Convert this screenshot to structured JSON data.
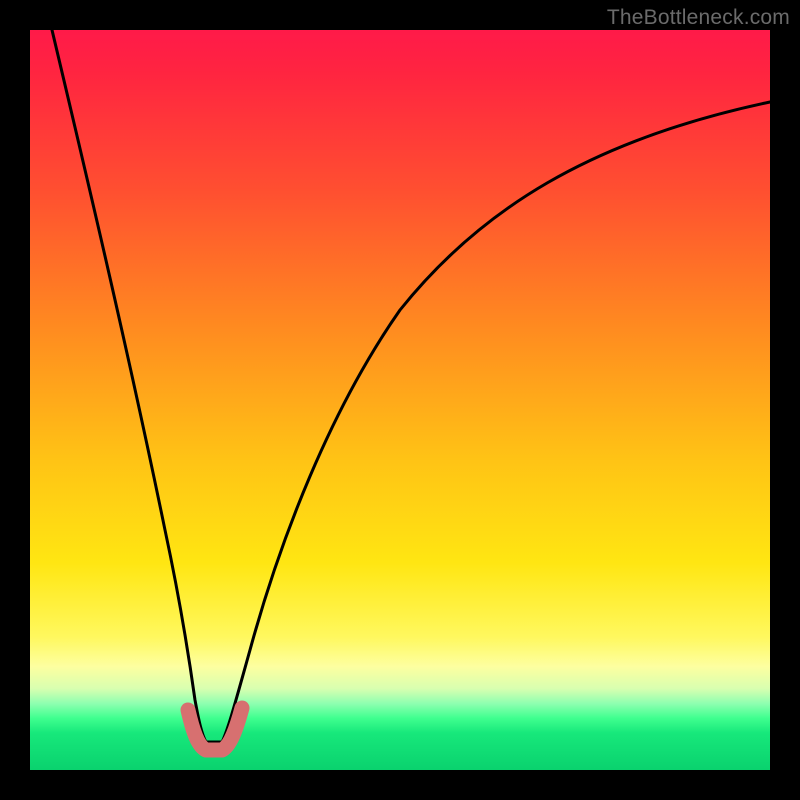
{
  "watermark": "TheBottleneck.com",
  "chart_data": {
    "type": "line",
    "title": "",
    "xlabel": "",
    "ylabel": "",
    "xlim": [
      0,
      100
    ],
    "ylim": [
      0,
      100
    ],
    "grid": false,
    "legend": false,
    "series": [
      {
        "name": "bottleneck-curve",
        "x": [
          3,
          6,
          9,
          12,
          15,
          18,
          20,
          22,
          24,
          26,
          28,
          32,
          38,
          46,
          56,
          68,
          82,
          100
        ],
        "values": [
          100,
          88,
          75,
          62,
          48,
          33,
          20,
          8,
          3,
          3,
          8,
          22,
          40,
          56,
          68,
          78,
          85,
          90
        ]
      }
    ],
    "highlight": {
      "name": "optimal-range",
      "x": [
        20,
        22,
        24,
        26
      ],
      "values": [
        8,
        3,
        3,
        8
      ]
    },
    "background_gradient": {
      "top": "#ff1a49",
      "mid": "#ffe612",
      "bottom": "#0ad26e"
    }
  }
}
